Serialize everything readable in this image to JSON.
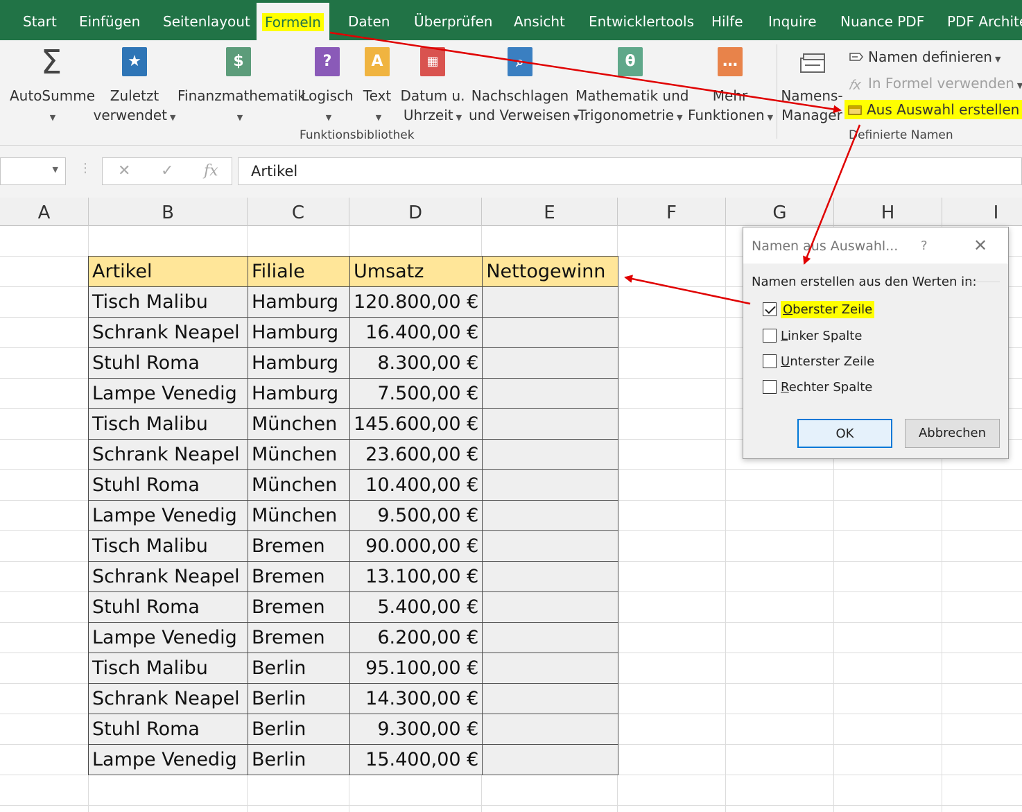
{
  "tabs": [
    {
      "label": "Start"
    },
    {
      "label": "Einfügen"
    },
    {
      "label": "Seitenlayout"
    },
    {
      "label": "Formeln"
    },
    {
      "label": "Daten"
    },
    {
      "label": "Überprüfen"
    },
    {
      "label": "Ansicht"
    },
    {
      "label": "Entwicklertools"
    },
    {
      "label": "Hilfe"
    },
    {
      "label": "Inquire"
    },
    {
      "label": "Nuance PDF"
    },
    {
      "label": "PDF Archite"
    }
  ],
  "ribbon": {
    "function_library": {
      "group_label": "Funktionsbibliothek",
      "buttons": [
        {
          "line1": "AutoSumme",
          "line2": "",
          "icon": "sigma-icon"
        },
        {
          "line1": "Zuletzt",
          "line2": "verwendet",
          "icon": "star-book-icon"
        },
        {
          "line1": "Finanzmathematik",
          "line2": "",
          "icon": "finance-book-icon"
        },
        {
          "line1": "Logisch",
          "line2": "",
          "icon": "question-book-icon"
        },
        {
          "line1": "Text",
          "line2": "",
          "icon": "text-book-icon"
        },
        {
          "line1": "Datum u.",
          "line2": "Uhrzeit",
          "icon": "calendar-book-icon"
        },
        {
          "line1": "Nachschlagen",
          "line2": "und Verweisen",
          "icon": "lookup-book-icon"
        },
        {
          "line1": "Mathematik und",
          "line2": "Trigonometrie",
          "icon": "theta-book-icon"
        },
        {
          "line1": "Mehr",
          "line2": "Funktionen",
          "icon": "more-book-icon"
        }
      ]
    },
    "defined_names": {
      "group_label": "Definierte Namen",
      "manager_line1": "Namens-",
      "manager_line2": "Manager",
      "define_name": "Namen definieren",
      "use_in_formula": "In Formel verwenden",
      "create_from_selection": "Aus Auswahl erstellen"
    }
  },
  "formula_bar": {
    "name_box": "",
    "cancel_symbol": "✕",
    "enter_symbol": "✓",
    "fx_symbol": "fx",
    "content": "Artikel"
  },
  "columns": [
    "A",
    "B",
    "C",
    "D",
    "E",
    "F",
    "G",
    "H",
    "I"
  ],
  "table": {
    "headers": [
      "Artikel",
      "Filiale",
      "Umsatz",
      "Nettogewinn"
    ],
    "rows": [
      [
        "Tisch Malibu",
        "Hamburg",
        "120.800,00 €",
        ""
      ],
      [
        "Schrank Neapel",
        "Hamburg",
        "16.400,00 €",
        ""
      ],
      [
        "Stuhl Roma",
        "Hamburg",
        "8.300,00 €",
        ""
      ],
      [
        "Lampe Venedig",
        "Hamburg",
        "7.500,00 €",
        ""
      ],
      [
        "Tisch Malibu",
        "München",
        "145.600,00 €",
        ""
      ],
      [
        "Schrank Neapel",
        "München",
        "23.600,00 €",
        ""
      ],
      [
        "Stuhl Roma",
        "München",
        "10.400,00 €",
        ""
      ],
      [
        "Lampe Venedig",
        "München",
        "9.500,00 €",
        ""
      ],
      [
        "Tisch Malibu",
        "Bremen",
        "90.000,00 €",
        ""
      ],
      [
        "Schrank Neapel",
        "Bremen",
        "13.100,00 €",
        ""
      ],
      [
        "Stuhl Roma",
        "Bremen",
        "5.400,00 €",
        ""
      ],
      [
        "Lampe Venedig",
        "Bremen",
        "6.200,00 €",
        ""
      ],
      [
        "Tisch Malibu",
        "Berlin",
        "95.100,00 €",
        ""
      ],
      [
        "Schrank Neapel",
        "Berlin",
        "14.300,00 €",
        ""
      ],
      [
        "Stuhl Roma",
        "Berlin",
        "9.300,00 €",
        ""
      ],
      [
        "Lampe Venedig",
        "Berlin",
        "15.400,00 €",
        ""
      ]
    ]
  },
  "dialog": {
    "title": "Namen aus Auswahl...",
    "help": "?",
    "close": "✕",
    "prompt": "Namen erstellen aus den Werten in:",
    "options": [
      {
        "key": "O",
        "rest": "berster Zeile",
        "checked": true
      },
      {
        "key": "L",
        "rest": "inker Spalte",
        "checked": false
      },
      {
        "key": "U",
        "rest": "nterster Zeile",
        "checked": false
      },
      {
        "key": "R",
        "rest": "echter Spalte",
        "checked": false
      }
    ],
    "ok": "OK",
    "cancel": "Abbrechen"
  },
  "colors": {
    "excel_green": "#217346",
    "highlight": "#ffff00",
    "header_fill": "#ffe699",
    "arrow": "#e00000"
  }
}
